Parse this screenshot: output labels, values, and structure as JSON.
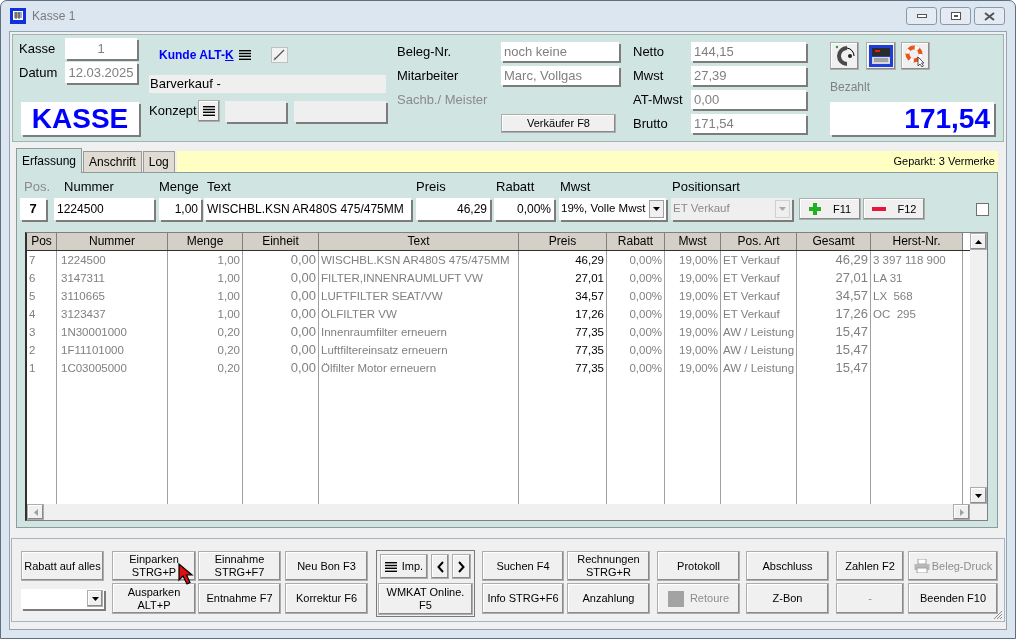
{
  "window": {
    "title": "Kasse 1"
  },
  "header": {
    "register": {
      "label": "Kasse",
      "value": "1"
    },
    "date": {
      "label": "Datum",
      "value": "12.03.2025"
    },
    "mode_title": "KASSE",
    "customer_link": {
      "text": "Kunde ALT-",
      "access_key": "K"
    },
    "customer_name": "Barverkauf -",
    "concept_label": "Konzept",
    "receipt_no": {
      "label": "Beleg-Nr.",
      "value": "noch keine"
    },
    "employee": {
      "label": "Mitarbeiter",
      "value": "Marc, Vollgas"
    },
    "clerk": {
      "label": "Sachb./ Meister",
      "disabled": true
    },
    "seller_button": "Verkäufer F8",
    "totals": [
      {
        "label": "Netto",
        "value": "144,15"
      },
      {
        "label": "Mwst",
        "value": "27,39"
      },
      {
        "label": "AT-Mwst",
        "value": "0,00"
      },
      {
        "label": "Brutto",
        "value": "171,54"
      }
    ],
    "paid": {
      "label": "Bezahlt",
      "value": "171,54"
    }
  },
  "tabs": [
    {
      "label": "Erfassung",
      "selected": true
    },
    {
      "label": "Anschrift",
      "selected": false
    },
    {
      "label": "Log",
      "selected": false
    }
  ],
  "parked_note": "Geparkt: 3 Vermerke",
  "entry": {
    "fields": [
      {
        "kind": "position",
        "label": "Pos.",
        "value": "7",
        "disabled": true
      },
      {
        "kind": "text",
        "label": "Nummer",
        "value": "1224500",
        "disabled": false
      },
      {
        "kind": "number",
        "label": "Menge",
        "value": "1,00",
        "disabled": false
      },
      {
        "kind": "text",
        "label": "Text",
        "value": "WISCHBL.KSN AR480S 475/475MM",
        "disabled": false
      },
      {
        "kind": "number",
        "label": "Preis",
        "value": "46,29",
        "disabled": false
      },
      {
        "kind": "number",
        "label": "Rabatt",
        "value": "0,00%",
        "disabled": false
      },
      {
        "kind": "select",
        "label": "Mwst",
        "value": "19%, Volle Mwst",
        "disabled": false
      },
      {
        "kind": "select",
        "label": "Positionsart",
        "value": "ET Verkauf",
        "disabled": true
      }
    ],
    "buttons": [
      {
        "kind": "add",
        "label": "F11"
      },
      {
        "kind": "remove",
        "label": "F12"
      }
    ],
    "checkbox": {
      "checked": false
    }
  },
  "table": {
    "columns": [
      "Pos",
      "Nummer",
      "Menge",
      "Einheit",
      "Text",
      "Preis",
      "Rabatt",
      "Mwst",
      "Pos. Art",
      "Gesamt",
      "Herst-Nr."
    ],
    "rows": [
      {
        "cells": [
          "7",
          "1224500",
          "1,00",
          "0,00",
          "WISCHBL.KSN AR480S 475/475MM",
          "46,29",
          "0,00%",
          "19,00%",
          "ET Verkauf",
          "46,29",
          "3 397 118 900"
        ]
      },
      {
        "cells": [
          "6",
          "3147311",
          "1,00",
          "0,00",
          "FILTER,INNENRAUMLUFT VW",
          "27,01",
          "0,00%",
          "19,00%",
          "ET Verkauf",
          "27,01",
          "LA 31"
        ]
      },
      {
        "cells": [
          "5",
          "3110665",
          "1,00",
          "0,00",
          "LUFTFILTER SEAT/VW",
          "34,57",
          "0,00%",
          "19,00%",
          "ET Verkauf",
          "34,57",
          "LX  568"
        ]
      },
      {
        "cells": [
          "4",
          "3123437",
          "1,00",
          "0,00",
          "ÖLFILTER VW",
          "17,26",
          "0,00%",
          "19,00%",
          "ET Verkauf",
          "17,26",
          "OC  295"
        ]
      },
      {
        "cells": [
          "3",
          "1N30001000",
          "0,20",
          "0,00",
          "Innenraumfilter erneuern",
          "77,35",
          "0,00%",
          "19,00%",
          "AW / Leistung",
          "15,47"
        ]
      },
      {
        "cells": [
          "2",
          "1F11101000",
          "0,20",
          "0,00",
          "Luftfiltereinsatz erneuern",
          "77,35",
          "0,00%",
          "19,00%",
          "AW / Leistung",
          "15,47"
        ]
      },
      {
        "cells": [
          "1",
          "1C03005000",
          "0,20",
          "0,00",
          "Ölfilter Motor erneuern",
          "77,35",
          "0,00%",
          "19,00%",
          "AW / Leistung",
          "15,47"
        ]
      }
    ]
  },
  "toolbar": [
    {
      "top": {
        "kind": "button",
        "label": "Rabatt auf alles",
        "disabled": false
      },
      "bottom": {
        "kind": "combo",
        "disabled": false
      }
    },
    {
      "top": {
        "kind": "button",
        "label": "Einparken\nSTRG+P",
        "disabled": false
      },
      "bottom": {
        "kind": "button",
        "label": "Ausparken\nALT+P",
        "disabled": false
      }
    },
    {
      "top": {
        "kind": "button",
        "label": "Einnahme\nSTRG+F7",
        "disabled": false
      },
      "bottom": {
        "kind": "button",
        "label": "Entnahme F7",
        "disabled": false
      }
    },
    {
      "top": {
        "kind": "button",
        "label": "Neu Bon F3",
        "disabled": false
      },
      "bottom": {
        "kind": "button",
        "label": "Korrektur F6",
        "disabled": false
      }
    },
    {
      "top": {
        "kind": "navigator",
        "label": "Imp.",
        "disabled": false
      },
      "bottom": {
        "kind": "button",
        "label": "WMKAT Online.\nF5",
        "disabled": false
      }
    },
    {
      "top": {
        "kind": "button",
        "label": "Suchen F4",
        "disabled": false
      },
      "bottom": {
        "kind": "button",
        "label": "Info STRG+F6",
        "disabled": false
      }
    },
    {
      "top": {
        "kind": "button",
        "label": "Rechnungen\nSTRG+R",
        "disabled": false
      },
      "bottom": {
        "kind": "button",
        "label": "Anzahlung",
        "disabled": false
      }
    },
    {
      "top": {
        "kind": "button",
        "label": "Protokoll",
        "disabled": false
      },
      "bottom": {
        "kind": "toggle",
        "label": "Retoure",
        "disabled": true
      }
    },
    {
      "top": {
        "kind": "button",
        "label": "Abschluss",
        "disabled": false
      },
      "bottom": {
        "kind": "button",
        "label": "Z-Bon",
        "disabled": false
      }
    },
    {
      "top": {
        "kind": "button",
        "label": "Zahlen F2",
        "disabled": false
      },
      "bottom": {
        "kind": "button",
        "label": "-",
        "disabled": true
      }
    },
    {
      "top": {
        "kind": "print",
        "label": "Beleg-Druck",
        "disabled": true
      },
      "bottom": {
        "kind": "button",
        "label": "Beenden F10",
        "disabled": false
      }
    }
  ]
}
